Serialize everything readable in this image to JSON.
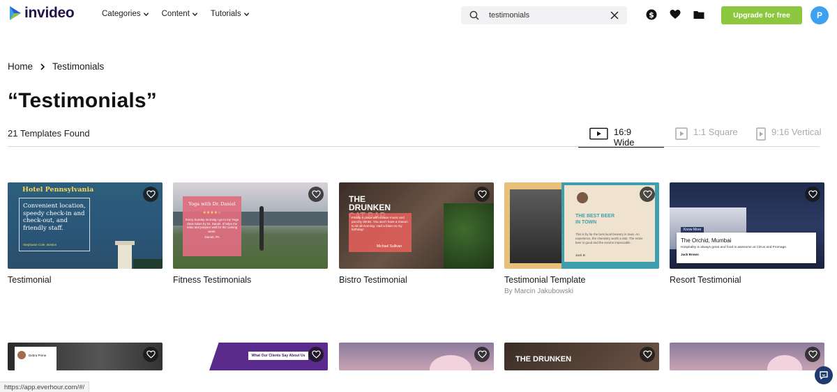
{
  "nav": {
    "logo_text": "invideo",
    "menu": [
      {
        "label": "Categories"
      },
      {
        "label": "Content"
      },
      {
        "label": "Tutorials"
      }
    ],
    "search_value": "testimonials",
    "upgrade_label": "Upgrade for free",
    "avatar_initial": "P"
  },
  "breadcrumb": {
    "home": "Home",
    "current": "Testimonials"
  },
  "page_title": "“Testimonials”",
  "results_count": "21 Templates Found",
  "aspect_tabs": [
    {
      "label": "16:9 Wide",
      "active": true
    },
    {
      "label": "1:1 Square",
      "active": false
    },
    {
      "label": "9:16 Vertical",
      "active": false
    }
  ],
  "cards": [
    {
      "title": "Testimonial",
      "author": "",
      "thumb": {
        "heading": "Hotel Pennsylvania",
        "quote": "Convenient location, speedy check-in and check-out, and friendly staff.",
        "name": "Stephanie Cole, Boston"
      }
    },
    {
      "title": "Fitness Testimonials",
      "author": "",
      "thumb": {
        "heading": "Yoga with Dr. Daniel",
        "stars": "★★★★☆",
        "quote": "Every Sunday morning I go to my Yoga class taken by Dr. Daniel. It helps me relax and prepare well for the coming week.",
        "name": "Daniel, PA"
      }
    },
    {
      "title": "Bistro Testimonial",
      "author": "",
      "thumb": {
        "heading": "THE DRUNKEN CAT BAR",
        "quote": "Finally a place with insane music and punchy drinks. You won't have a reason to sit all evening. Had a blast on my birthday!",
        "name": "Michael Sullivan"
      }
    },
    {
      "title": "Testimonial Template",
      "author": "By Marcin Jakubowski",
      "thumb": {
        "heading": "THE BEST BEER IN TOWN",
        "quote": "This is by far the best local brewery in town. An experience, the chemistry worth a visit. The entire beer is good and the service impeccable.",
        "name": "Jack B"
      }
    },
    {
      "title": "Resort Testimonial",
      "author": "",
      "thumb": {
        "tag": "Know More",
        "heading": "The Orchid, Mumbai",
        "quote": "Hospitality is always great and food is awesome at Citrus and Fromage.",
        "name": "Jack Brown"
      }
    }
  ],
  "row2": {
    "card1_name": "Debra Prime",
    "card2_heading": "What Our Clients Say About Us",
    "card4_heading": "THE DRUNKEN"
  },
  "status_url": "https://app.everhour.com/#/",
  "colors": {
    "brand": "#24124f",
    "upgrade": "#8dc63f",
    "avatar": "#3ba1f0"
  }
}
